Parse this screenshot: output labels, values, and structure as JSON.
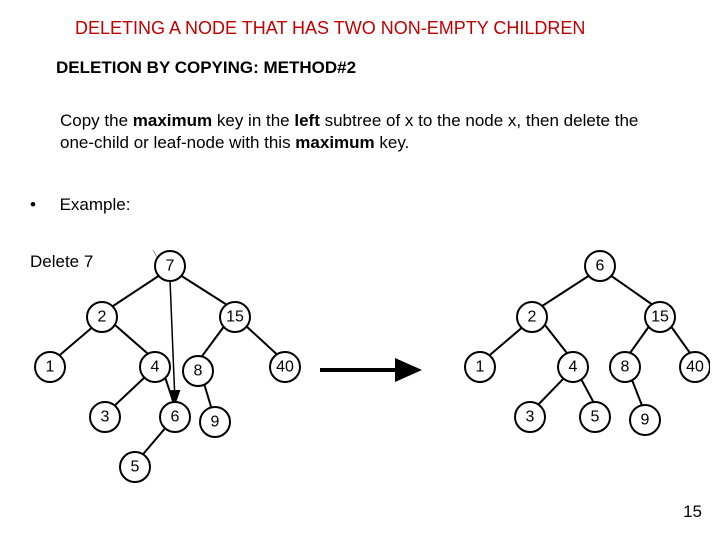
{
  "title": "DELETING A NODE THAT HAS TWO NON-EMPTY CHILDREN",
  "subtitle": "DELETION BY COPYING: METHOD#2",
  "paragraph_prefix": " Copy the ",
  "w_maximum": "maximum",
  "p2": " key in the ",
  "w_left": "left",
  "p3": " subtree of x to the node x, then delete the one-child or leaf-node with this ",
  "w_maximum2": "maximum",
  "p4": " key.",
  "example_bullet": "•",
  "example_label": "Example:",
  "delete7": "Delete 7",
  "pagenum": "15",
  "left_tree": {
    "root": "7",
    "n2": "2",
    "n15": "15",
    "n1": "1",
    "n4": "4",
    "n8": "8",
    "n40": "40",
    "n3": "3",
    "n6": "6",
    "n9": "9",
    "n5": "5"
  },
  "right_tree": {
    "root": "6",
    "n2": "2",
    "n15": "15",
    "n1": "1",
    "n4": "4",
    "n8": "8",
    "n40": "40",
    "n3": "3",
    "n5": "5",
    "n9": "9"
  }
}
